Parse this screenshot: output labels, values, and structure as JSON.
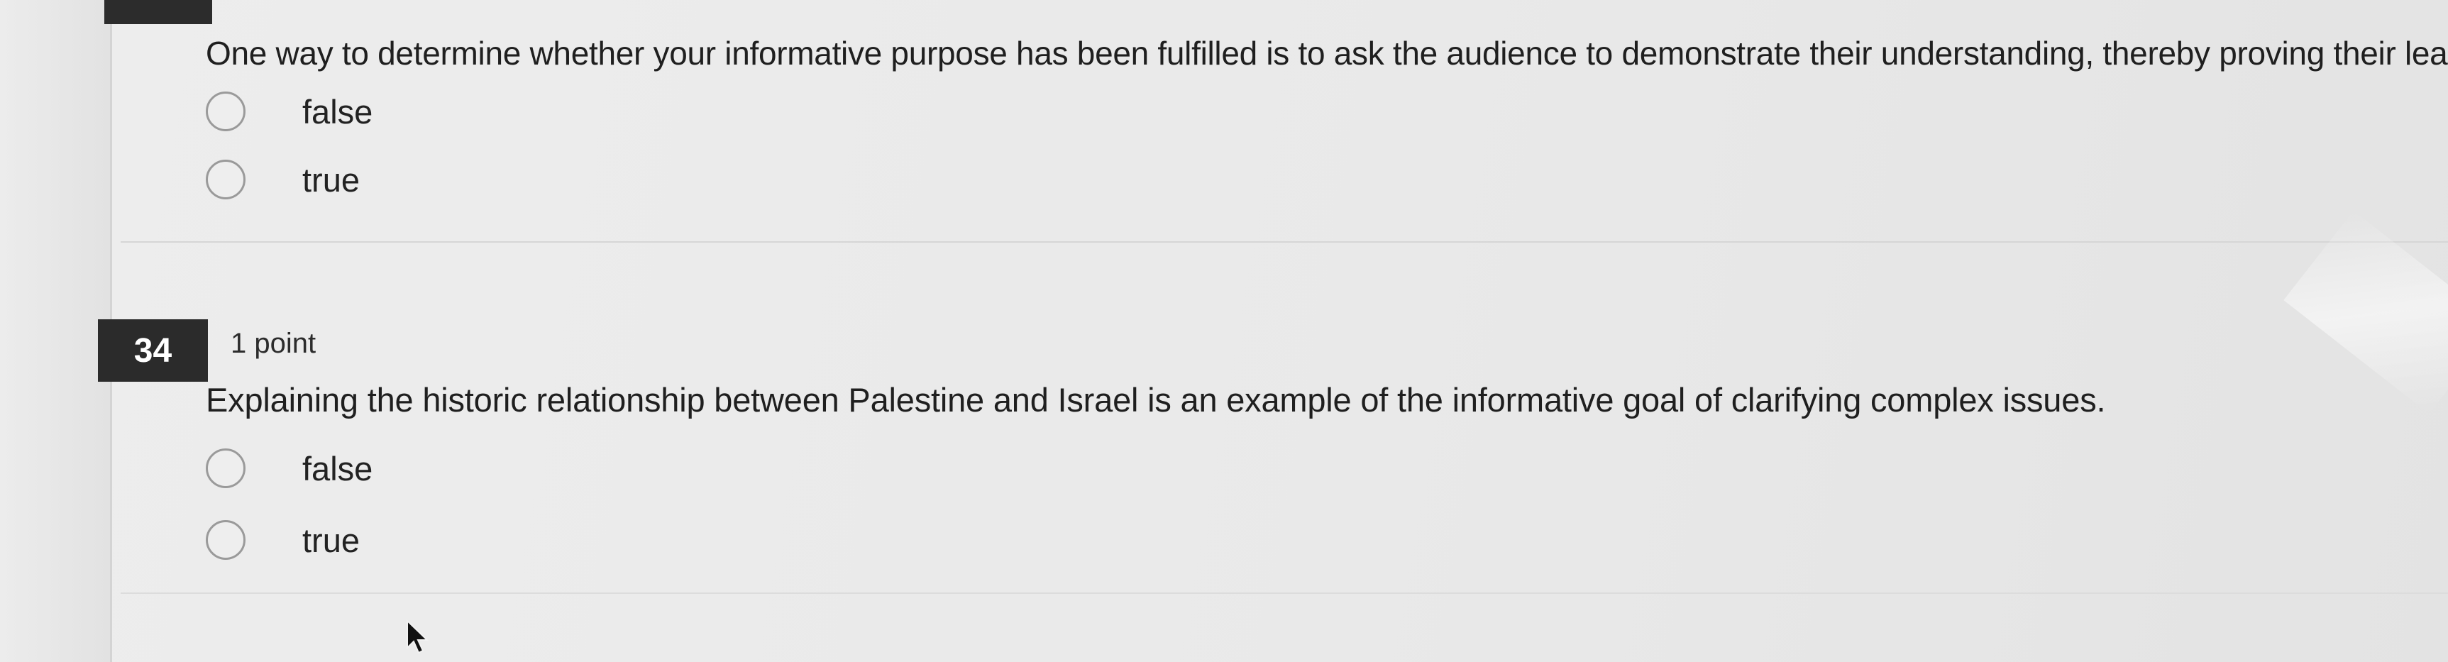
{
  "questions": [
    {
      "text": "One way to determine whether your informative purpose has been fulfilled is to ask the audience to demonstrate their understanding, thereby proving their learning.",
      "options": [
        "false",
        "true"
      ]
    },
    {
      "number": "34",
      "points": "1 point",
      "text": "Explaining the historic relationship between Palestine and Israel is an example of the informative goal of clarifying complex issues.",
      "options": [
        "false",
        "true"
      ]
    }
  ],
  "icons": {
    "radio": "radio-button-icon",
    "cursor": "mouse-pointer-icon"
  },
  "colors": {
    "badge": "#2b2b2b",
    "background": "#e9e9e9",
    "radio_border": "#9a9a9a"
  }
}
